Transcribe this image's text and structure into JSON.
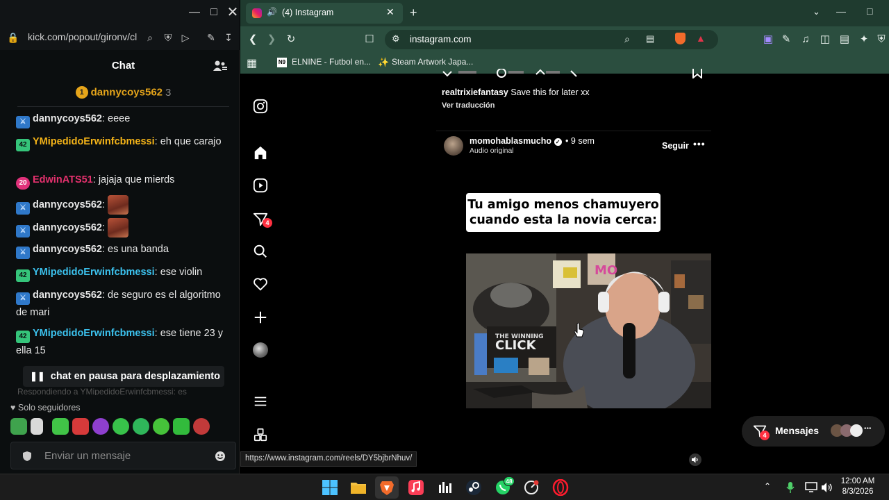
{
  "kick": {
    "url": "kick.com/popout/gironv/cl",
    "chat_title": "Chat",
    "pinned": {
      "rank": "1",
      "name": "dannycoys562",
      "count": "3"
    },
    "messages": [
      {
        "badge": "",
        "badge_type": "blue",
        "user": "dannycoys562",
        "user_color": "#ffffff",
        "text": "eeee"
      },
      {
        "badge": "42",
        "badge_type": "green",
        "user": "YMipedidoErwinfcbmessi",
        "user_color": "#f5b418",
        "text": "eh que carajo"
      },
      {
        "badge": "20",
        "badge_type": "pink",
        "user": "EdwinATS51",
        "user_color": "#e6316e",
        "text": "jajaja que mierds"
      },
      {
        "badge": "",
        "badge_type": "blue",
        "user": "dannycoys562",
        "user_color": "#ffffff",
        "text": ""
      },
      {
        "badge": "",
        "badge_type": "blue",
        "user": "dannycoys562",
        "user_color": "#ffffff",
        "text": ""
      },
      {
        "badge": "",
        "badge_type": "blue",
        "user": "dannycoys562",
        "user_color": "#ffffff",
        "text": "es una banda"
      },
      {
        "badge": "42",
        "badge_type": "green",
        "user": "YMipedidoErwinfcbmessi",
        "user_color": "#3cc2ee",
        "text": "ese violin"
      },
      {
        "badge": "",
        "badge_type": "blue",
        "user": "dannycoys562",
        "user_color": "#ffffff",
        "text": "de seguro es el algoritmo de mari"
      },
      {
        "badge": "42",
        "badge_type": "green",
        "user": "YMipedidoErwinfcbmessi",
        "user_color": "#3cc2ee",
        "text": "ese tiene 23 y ella 15"
      }
    ],
    "pause_label": "chat en pausa para desplazamiento",
    "reply_preview": "Respondiendo a YMipedidoErwinfcbmessi: es",
    "followers_only": "Solo seguidores",
    "input_placeholder": "Enviar un mensaje"
  },
  "browser": {
    "tab_title": "(4) Instagram",
    "address": "instagram.com",
    "bookmarks": [
      "ELNINE - Futbol en...",
      "Steam Artwork Japa..."
    ],
    "status_url": "https://www.instagram.com/reels/DY5bjbrNhuv/"
  },
  "instagram": {
    "prev_post": {
      "user": "realtrixiefantasy",
      "caption": "Save this for later xx",
      "translate": "Ver traducción"
    },
    "post": {
      "user": "momohablasmucho",
      "age": "9 sem",
      "audio": "Audio original",
      "follow": "Seguir",
      "caption": "Tu amigo menos chamuyero cuando esta la novia cerca:"
    },
    "notifications_badge": "4",
    "messages_label": "Mensajes",
    "messages_badge": "4"
  },
  "taskbar": {
    "whatsapp_badge": "48",
    "time": "12:00 AM",
    "date": "8/3/2026"
  }
}
